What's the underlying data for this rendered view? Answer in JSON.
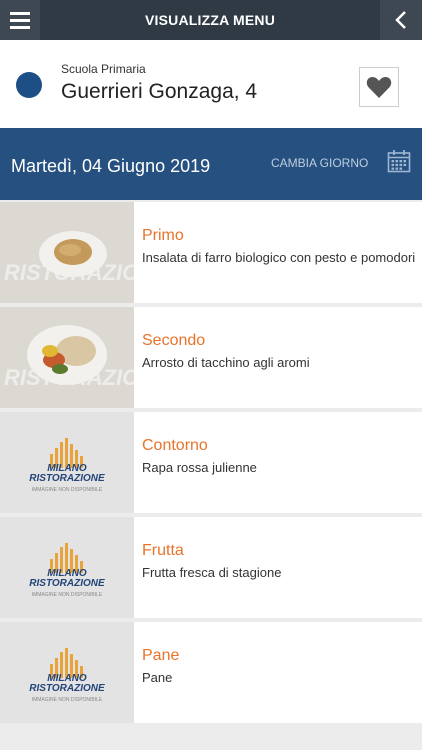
{
  "header": {
    "title": "VISUALIZZA MENU"
  },
  "school": {
    "type": "Scuola Primaria",
    "name": "Guerrieri Gonzaga, 4"
  },
  "date_bar": {
    "date": "Martedì, 04 Giugno 2019",
    "change_day": "CAMBIA GIORNO"
  },
  "placeholder": {
    "brand_line1": "MILANO",
    "brand_line2": "RISTORAZIONE",
    "caption": "IMMAGINE NON DISPONIBILE"
  },
  "menu": [
    {
      "course": "Primo",
      "dish": "Insalata di farro biologico con pesto e pomodori"
    },
    {
      "course": "Secondo",
      "dish": "Arrosto di tacchino agli aromi"
    },
    {
      "course": "Contorno",
      "dish": "Rapa rossa julienne"
    },
    {
      "course": "Frutta",
      "dish": "Frutta fresca di stagione"
    },
    {
      "course": "Pane",
      "dish": "Pane"
    }
  ],
  "colors": {
    "top_bar": "#2f3a45",
    "date_bar": "#25507f",
    "course_label": "#e8742b",
    "school_dot": "#1e4e86"
  },
  "icons": [
    "menu-icon",
    "chevron-left-icon",
    "heart-icon",
    "calendar-icon"
  ]
}
